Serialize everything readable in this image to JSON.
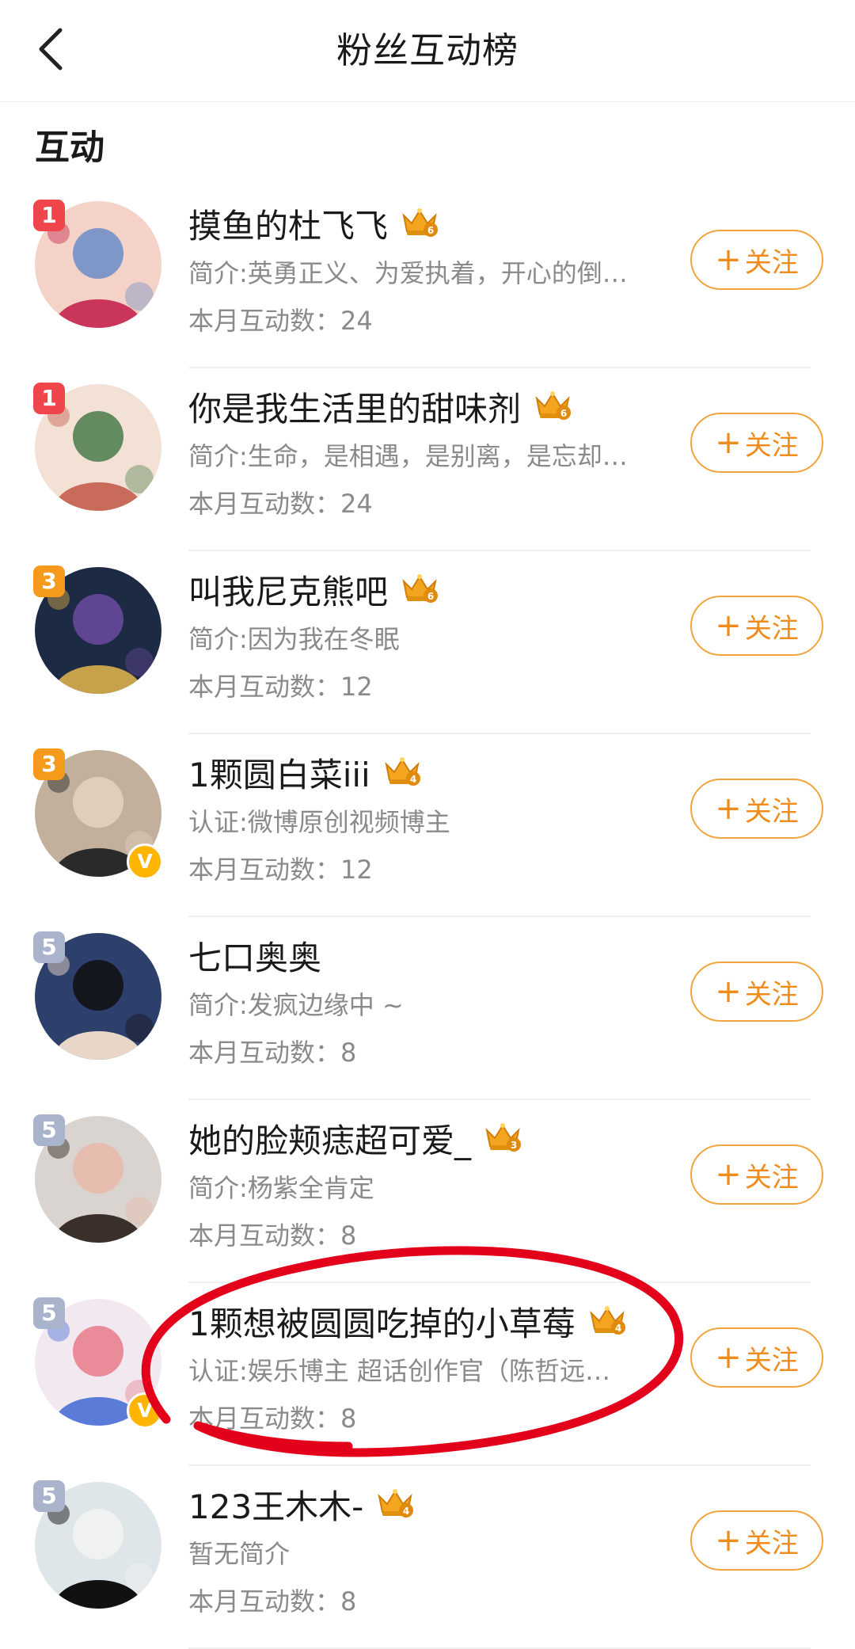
{
  "header": {
    "title": "粉丝互动榜"
  },
  "section": {
    "title": "互动"
  },
  "follow_label": "关注",
  "follow_plus": "+",
  "count_prefix": "本月互动数：",
  "colors": {
    "accent": "#f08c1c",
    "rank_top": "#f0454b",
    "rank_mid": "#f59a1a",
    "rank_other": "#a9b4cc",
    "verified": "#ffb400",
    "annotation": "#e3001b"
  },
  "rows": [
    {
      "rank": "1",
      "name": "摸鱼的杜飞飞",
      "crown_level": "6",
      "bio": "简介:英勇正义、为爱执着，开心的倒…",
      "count": "24",
      "verified": false
    },
    {
      "rank": "1",
      "name": "你是我生活里的甜味剂",
      "crown_level": "6",
      "bio": "简介:生命，是相遇，是别离，是忘却…",
      "count": "24",
      "verified": false
    },
    {
      "rank": "3",
      "name": "叫我尼克熊吧",
      "crown_level": "6",
      "bio": "简介:因为我在冬眠",
      "count": "12",
      "verified": false
    },
    {
      "rank": "3",
      "name": "1颗圆白菜iii",
      "crown_level": "4",
      "bio": "认证:微博原创视频博主",
      "count": "12",
      "verified": true
    },
    {
      "rank": "5",
      "name": "七口奥奥",
      "crown_level": "",
      "bio": "简介:发疯边缘中 ~",
      "count": "8",
      "verified": false
    },
    {
      "rank": "5",
      "name": "她的脸颊痣超可爱_",
      "crown_level": "3",
      "bio": "简介:杨紫全肯定",
      "count": "8",
      "verified": false
    },
    {
      "rank": "5",
      "name": "1颗想被圆圆吃掉的小草莓",
      "crown_level": "4",
      "bio": "认证:娱乐博主 超话创作官（陈哲远…",
      "count": "8",
      "verified": true
    },
    {
      "rank": "5",
      "name": "123王木木-",
      "crown_level": "4",
      "bio": "暂无简介",
      "count": "8",
      "verified": false
    }
  ]
}
